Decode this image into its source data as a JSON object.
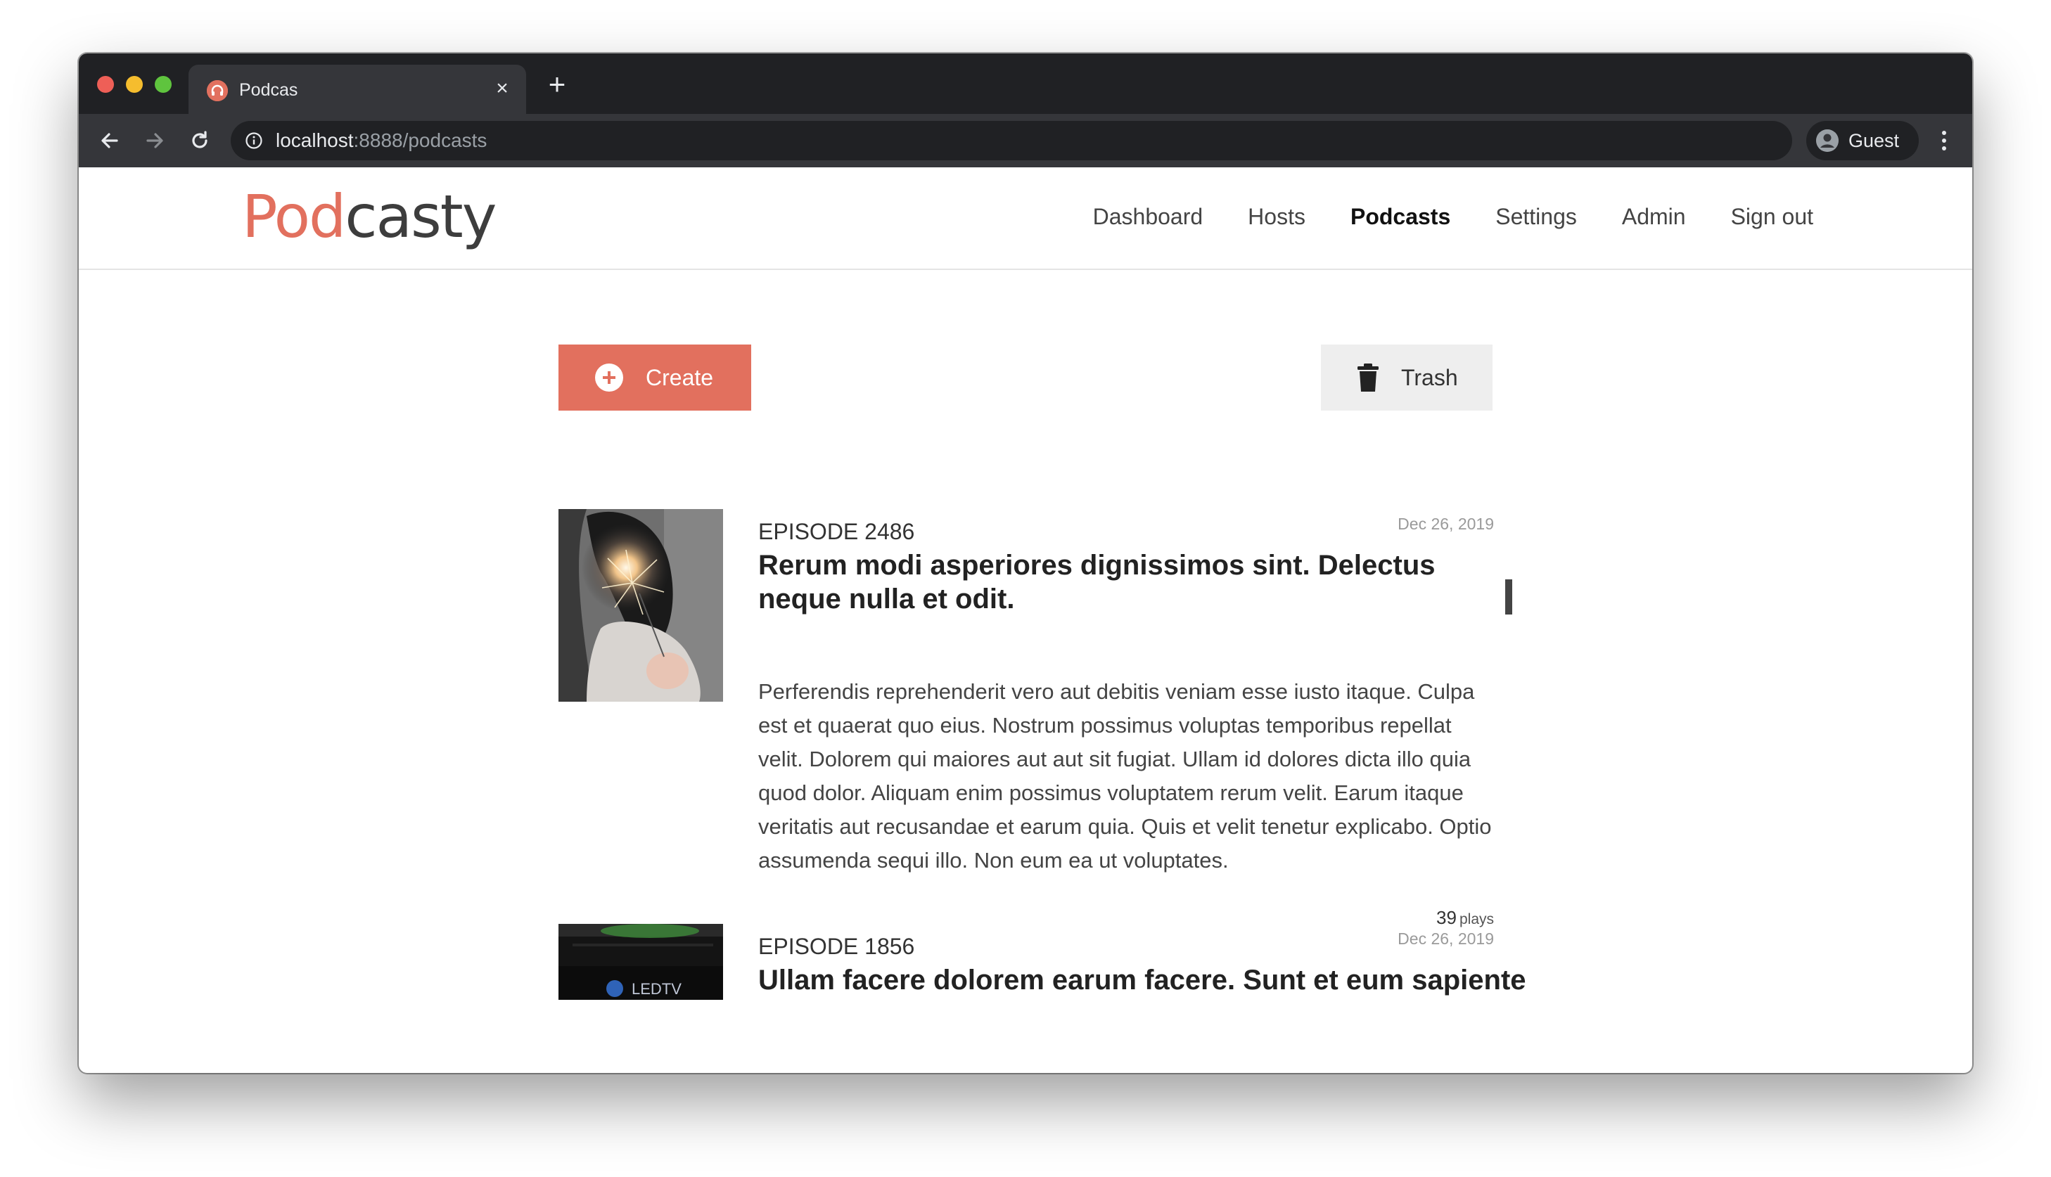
{
  "browser": {
    "tab_title": "Podcas",
    "tab_close": "×",
    "new_tab": "+",
    "url_host": "localhost",
    "url_rest": ":8888/podcasts",
    "profile_label": "Guest"
  },
  "site": {
    "logo_pod": "Pod",
    "logo_casty": "casty",
    "nav": [
      "Dashboard",
      "Hosts",
      "Podcasts",
      "Settings",
      "Admin",
      "Sign out"
    ],
    "active_nav": "Podcasts"
  },
  "actions": {
    "create_label": "Create",
    "trash_label": "Trash"
  },
  "episodes": [
    {
      "number": "EPISODE 2486",
      "date": "Dec 26, 2019",
      "title": "Rerum modi asperiores dignissimos sint. Delectus neque nulla et odit.",
      "description": "Perferendis reprehenderit vero aut debitis veniam esse iusto itaque. Culpa est et quaerat quo eius. Nostrum possimus voluptas temporibus repellat velit. Dolorem qui maiores aut aut sit fugiat. Ullam id dolores dicta illo quia quod dolor. Aliquam enim possimus voluptatem rerum velit. Earum itaque veritatis aut recusandae et earum quia. Quis et velit tenetur explicabo. Optio assumenda sequi illo. Non eum ea ut voluptates.",
      "plays_count": "39",
      "plays_label": "plays"
    },
    {
      "number": "EPISODE 1856",
      "date": "Dec 26, 2019",
      "title": "Ullam facere dolorem earum facere. Sunt et eum sapiente",
      "thumb_text": "LEDTV"
    }
  ],
  "colors": {
    "brand": "#e2705e",
    "text_dark": "#222222",
    "chrome_dark": "#202124",
    "chrome_mid": "#35363a"
  },
  "icons": {
    "back": "arrow-left-icon",
    "forward": "arrow-right-icon",
    "reload": "reload-icon",
    "info": "info-icon",
    "profile": "user-circle-icon",
    "menu": "more-vert-icon",
    "create": "plus-circle-icon",
    "trash": "trash-icon"
  }
}
